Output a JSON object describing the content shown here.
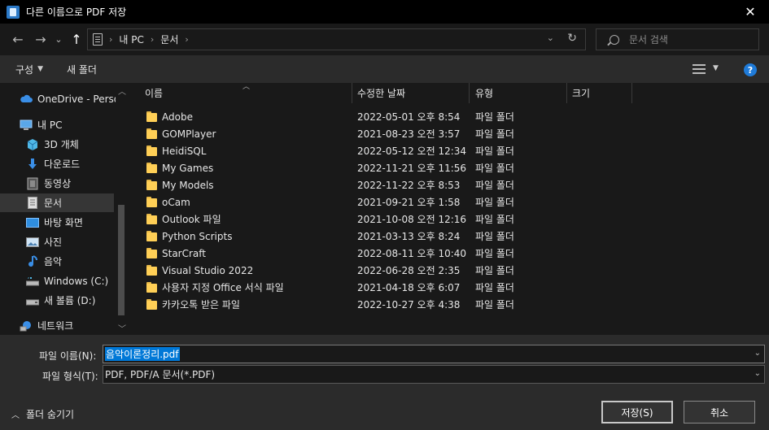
{
  "window": {
    "title": "다른 이름으로 PDF 저장",
    "close_glyph": "✕"
  },
  "navbar": {
    "back_glyph": "←",
    "forward_glyph": "→",
    "recent_glyph": "⌄",
    "up_glyph": "↑",
    "breadcrumb": [
      "내 PC",
      "문서"
    ],
    "breadcrumb_sep": "›",
    "refresh_glyph": "↻",
    "search_placeholder": "문서 검색"
  },
  "toolbar": {
    "organize_label": "구성",
    "new_folder_label": "새 폴더",
    "help_label": "?"
  },
  "sidebar": {
    "items": [
      {
        "label": "OneDrive - Personal",
        "icon": "cloud-icon",
        "selected": false
      },
      {
        "label": "내 PC",
        "icon": "pc-icon",
        "selected": false
      },
      {
        "label": "3D 개체",
        "icon": "3d-objects-icon",
        "selected": false
      },
      {
        "label": "다운로드",
        "icon": "download-icon",
        "selected": false
      },
      {
        "label": "동영상",
        "icon": "video-icon",
        "selected": false
      },
      {
        "label": "문서",
        "icon": "document-icon",
        "selected": true
      },
      {
        "label": "바탕 화면",
        "icon": "desktop-icon",
        "selected": false
      },
      {
        "label": "사진",
        "icon": "picture-icon",
        "selected": false
      },
      {
        "label": "음악",
        "icon": "music-icon",
        "selected": false
      },
      {
        "label": "Windows (C:)",
        "icon": "drive-icon",
        "selected": false
      },
      {
        "label": "새 볼륨 (D:)",
        "icon": "drive-icon",
        "selected": false
      },
      {
        "label": "네트워크",
        "icon": "network-icon",
        "selected": false
      }
    ]
  },
  "columns": {
    "name": "이름",
    "modified": "수정한 날짜",
    "type": "유형",
    "size": "크기"
  },
  "files": [
    {
      "name": "Adobe",
      "modified": "2022-05-01 오후 8:54",
      "type": "파일 폴더"
    },
    {
      "name": "GOMPlayer",
      "modified": "2021-08-23 오전 3:57",
      "type": "파일 폴더"
    },
    {
      "name": "HeidiSQL",
      "modified": "2022-05-12 오전 12:34",
      "type": "파일 폴더"
    },
    {
      "name": "My Games",
      "modified": "2022-11-21 오후 11:56",
      "type": "파일 폴더"
    },
    {
      "name": "My Models",
      "modified": "2022-11-22 오후 8:53",
      "type": "파일 폴더"
    },
    {
      "name": "oCam",
      "modified": "2021-09-21 오후 1:58",
      "type": "파일 폴더"
    },
    {
      "name": "Outlook 파일",
      "modified": "2021-10-08 오전 12:16",
      "type": "파일 폴더"
    },
    {
      "name": "Python Scripts",
      "modified": "2021-03-13 오후 8:24",
      "type": "파일 폴더"
    },
    {
      "name": "StarCraft",
      "modified": "2022-08-11 오후 10:40",
      "type": "파일 폴더"
    },
    {
      "name": "Visual Studio 2022",
      "modified": "2022-06-28 오전 2:35",
      "type": "파일 폴더"
    },
    {
      "name": "사용자 지정 Office 서식 파일",
      "modified": "2021-04-18 오후 6:07",
      "type": "파일 폴더"
    },
    {
      "name": "카카오톡 받은 파일",
      "modified": "2022-10-27 오후 4:38",
      "type": "파일 폴더"
    }
  ],
  "form": {
    "filename_label": "파일 이름(N):",
    "filename_value": "음악이론정리.pdf",
    "filetype_label": "파일 형식(T):",
    "filetype_value": "PDF, PDF/A 문서(*.PDF)",
    "hide_folders_label": "폴더 숨기기",
    "save_label": "저장(S)",
    "cancel_label": "취소"
  },
  "colors": {
    "accent": "#0078d7",
    "folder": "#ffcf56",
    "background": "#191919",
    "panel": "#2b2b2b"
  }
}
